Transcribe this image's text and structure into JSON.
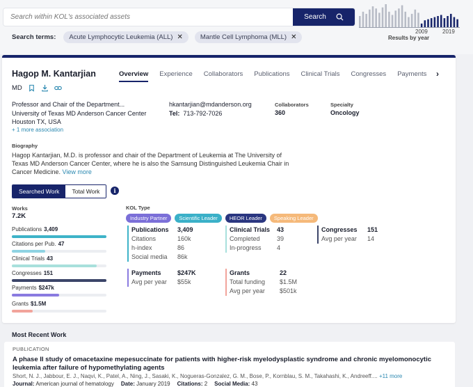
{
  "search": {
    "placeholder": "Search within KOL's associated assets",
    "button_label": "Search",
    "terms_label": "Search terms:",
    "terms": [
      "Acute Lymphocytic Leukemia (ALL)",
      "Mantle Cell Lymphoma (MLL)"
    ]
  },
  "sparkline": {
    "year_start": "2009",
    "year_end": "2019",
    "caption": "Results by year",
    "bars": [
      22,
      30,
      26,
      34,
      40,
      36,
      28,
      38,
      44,
      30,
      24,
      32,
      36,
      42,
      30,
      20,
      26,
      34,
      28,
      8,
      14,
      16,
      18,
      20,
      22,
      24,
      18,
      22,
      26,
      20,
      16
    ],
    "highlight_from_index": 19,
    "colors": {
      "muted": "#b8bcc6",
      "highlight": "#17246a"
    }
  },
  "profile": {
    "name": "Hagop M. Kantarjian",
    "degree": "MD",
    "title": "Professor and Chair of the Department...",
    "institution": "University of Texas MD Anderson Cancer Center",
    "location": "Houston TX, USA",
    "more_association": "+ 1 more association",
    "email": "hkantarjian@mdanderson.org",
    "tel_label": "Tel:",
    "tel": "713-792-7026",
    "collaborators_label": "Collaborators",
    "collaborators_value": "360",
    "specialty_label": "Specialty",
    "specialty_value": "Oncology",
    "biography_label": "Biography",
    "biography": "Hagop Kantarjian, M.D. is professor and chair of the Department of Leukemia at The University of Texas MD Anderson Cancer Center, where he is also the Samsung Distinguished Leukemia Chair in Cancer Medicine.",
    "view_more": "View more"
  },
  "tabs": [
    "Overview",
    "Experience",
    "Collaborators",
    "Publications",
    "Clinical Trials",
    "Congresses",
    "Payments"
  ],
  "toggle": {
    "searched": "Searched Work",
    "total": "Total Work"
  },
  "works": {
    "label": "Works",
    "value": "7.2K",
    "bars": [
      {
        "label": "Publications",
        "value": "3,409",
        "fraction": 1.0,
        "color": "#3eb3c8"
      },
      {
        "label": "Citations per Pub.",
        "value": "47",
        "fraction": 0.35,
        "color": "#8fd3e2"
      },
      {
        "label": "Clinical Trials",
        "value": "43",
        "fraction": 0.9,
        "color": "#a8e0dc"
      },
      {
        "label": "Congresses",
        "value": "151",
        "fraction": 1.0,
        "color": "#3c4569"
      },
      {
        "label": "Payments",
        "value": "$247k",
        "fraction": 0.5,
        "color": "#8a7be0"
      },
      {
        "label": "Grants",
        "value": "$1.5M",
        "fraction": 0.22,
        "color": "#f2a49b"
      }
    ]
  },
  "kol_type": {
    "label": "KOL Type",
    "badges": [
      {
        "label": "Industry Partner",
        "color": "#7b6fd8"
      },
      {
        "label": "Scientific Leader",
        "color": "#3ab0c8"
      },
      {
        "label": "HEOR Leader",
        "color": "#2a3680"
      },
      {
        "label": "Speaking Leader",
        "color": "#f5b97a"
      }
    ]
  },
  "metrics": {
    "publications": {
      "title": "Publications",
      "value": "3,409",
      "color": "#3eb3c8",
      "rows": [
        [
          "Citations",
          "160k"
        ],
        [
          "h-index",
          "86"
        ],
        [
          "Social media",
          "86k"
        ]
      ]
    },
    "clinical_trials": {
      "title": "Clinical Trials",
      "value": "43",
      "color": "#a8e0dc",
      "rows": [
        [
          "Completed",
          "39"
        ],
        [
          "In-progress",
          "4"
        ]
      ]
    },
    "congresses": {
      "title": "Congresses",
      "value": "151",
      "color": "#3c4569",
      "rows": [
        [
          "Avg per year",
          "14"
        ]
      ]
    },
    "payments": {
      "title": "Payments",
      "value": "$247K",
      "color": "#8a7be0",
      "rows": [
        [
          "Avg per year",
          "$55k"
        ]
      ]
    },
    "grants": {
      "title": "Grants",
      "value": "22",
      "color": "#f2a49b",
      "rows": [
        [
          "Total funding",
          "$1.5M"
        ],
        [
          "Avg per year",
          "$501k"
        ]
      ]
    }
  },
  "recent": {
    "label": "Most Recent Work",
    "tag": "PUBLICATION",
    "title": "A phase II study of omacetaxine mepesuccinate for patients with higher-risk myelodysplastic syndrome and chronic myelomonocytic leukemia after failure of hypomethylating agents",
    "authors": "Short, N. J., Jabbour, E. J., Naqvi, K., Patel, A., Ning, J., Sasaki, K., Nogueras-Gonzalez, G. M., Bose, P., Kornblau, S. M., Takahashi, K., Andreeff....",
    "more_authors": "+11 more",
    "journal_label": "Journal:",
    "journal": "American journal of hematology",
    "date_label": "Date:",
    "date": "January 2019",
    "citations_label": "Citations:",
    "citations": "2",
    "social_label": "Social Media:",
    "social": "43"
  }
}
